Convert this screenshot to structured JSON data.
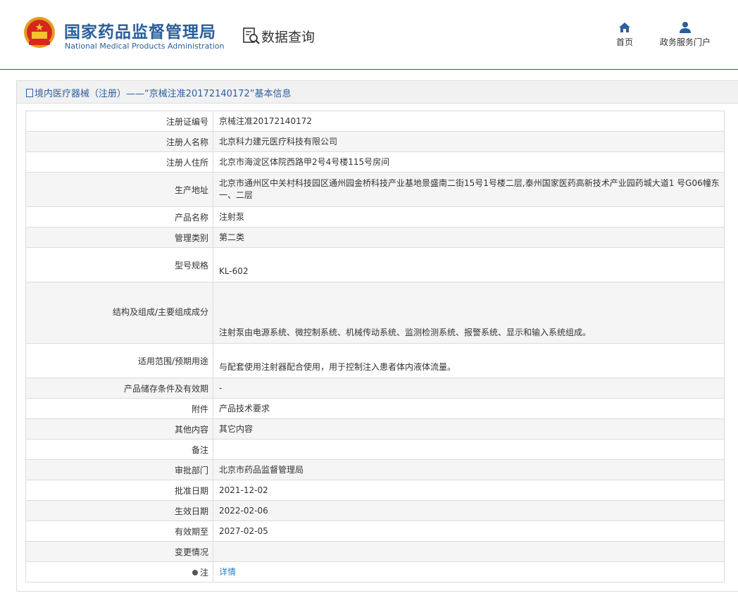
{
  "header": {
    "title_cn": "国家药品监督管理局",
    "title_en": "National Medical Products Administration",
    "query_label": "数据查询",
    "nav": [
      {
        "label": "首页",
        "icon": "home-icon"
      },
      {
        "label": "政务服务门户",
        "icon": "user-icon"
      }
    ]
  },
  "panel": {
    "title": "境内医疗器械（注册）——“京械注准20172140172”基本信息"
  },
  "rows": [
    {
      "label": "注册证编号",
      "value": "京械注准20172140172"
    },
    {
      "label": "注册人名称",
      "value": "北京科力建元医疗科技有限公司"
    },
    {
      "label": "注册人住所",
      "value": "北京市海淀区体院西路甲2号4号楼115号房间"
    },
    {
      "label": "生产地址",
      "value": "北京市通州区中关村科技园区通州园金桥科技产业基地景盛南二街15号1号楼二层,泰州国家医药高新技术产业园药城大道1 号G06幢东一、二层"
    },
    {
      "label": "产品名称",
      "value": "注射泵"
    },
    {
      "label": "管理类别",
      "value": "第二类"
    },
    {
      "label": "型号规格",
      "value": "KL-602"
    },
    {
      "label": "结构及组成/主要组成成分",
      "value": "注射泵由电源系统、微控制系统、机械传动系统、监测检测系统、报警系统、显示和输入系统组成。"
    },
    {
      "label": "适用范围/预期用途",
      "value": "与配套使用注射器配合使用，用于控制注入患者体内液体流量。"
    },
    {
      "label": "产品储存条件及有效期",
      "value": "-"
    },
    {
      "label": "附件",
      "value": "产品技术要求"
    },
    {
      "label": "其他内容",
      "value": "其它内容"
    },
    {
      "label": "备注",
      "value": ""
    },
    {
      "label": "审批部门",
      "value": "北京市药品监督管理局"
    },
    {
      "label": "批准日期",
      "value": "2021-12-02"
    },
    {
      "label": "生效日期",
      "value": "2022-02-06"
    },
    {
      "label": "有效期至",
      "value": "2027-02-05"
    },
    {
      "label": "变更情况",
      "value": ""
    },
    {
      "label": "注",
      "value": "详情"
    }
  ]
}
